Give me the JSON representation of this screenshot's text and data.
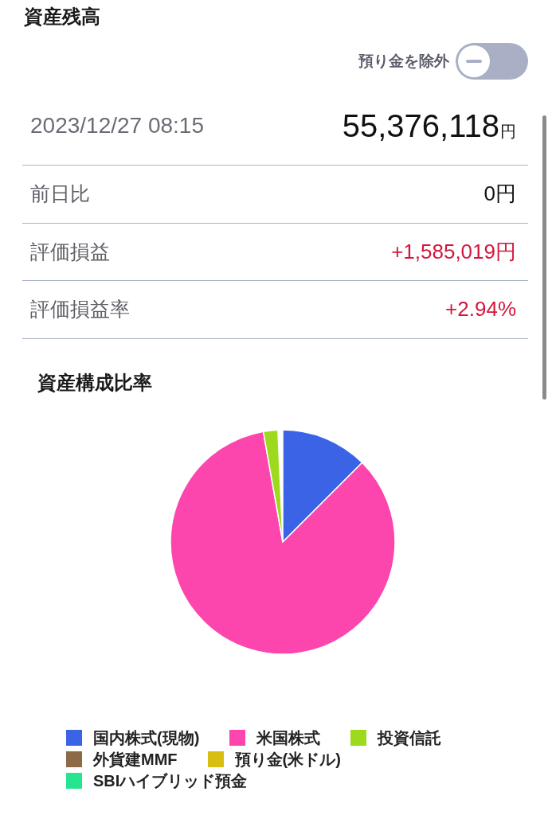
{
  "header": {
    "title": "資産残高"
  },
  "toggle": {
    "label": "預り金を除外",
    "on": false
  },
  "total": {
    "datetime": "2023/12/27 08:15",
    "amount": "55,376,118",
    "unit": "円"
  },
  "rows": [
    {
      "label": "前日比",
      "value": "0円",
      "kind": "plain"
    },
    {
      "label": "評価損益",
      "value": "+1,585,019円",
      "kind": "gain"
    },
    {
      "label": "評価損益率",
      "value": "+2.94%",
      "kind": "gain"
    }
  ],
  "composition": {
    "title": "資産構成比率",
    "legend": [
      {
        "label": "国内株式(現物)",
        "color": "#3a63e6"
      },
      {
        "label": "米国株式",
        "color": "#fc46ae"
      },
      {
        "label": "投資信託",
        "color": "#9dd91c"
      },
      {
        "label": "外貨建MMF",
        "color": "#8c6a47"
      },
      {
        "label": "預り金(米ドル)",
        "color": "#d7be10"
      },
      {
        "label": "SBIハイブリッド預金",
        "color": "#26e48f"
      }
    ]
  }
}
